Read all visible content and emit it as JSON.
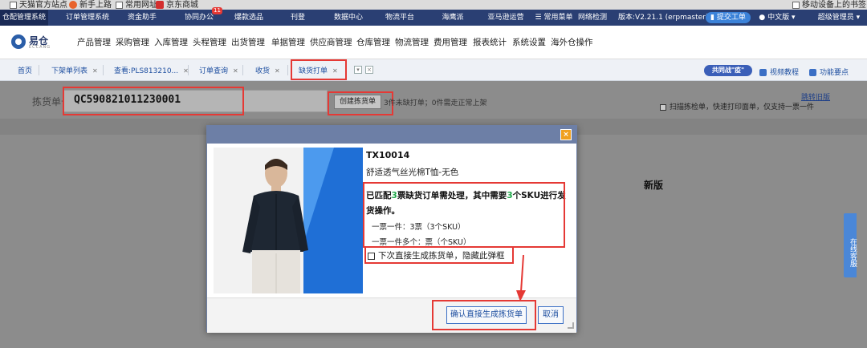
{
  "bookmarks": {
    "items": [
      "天猫官方站点",
      "新手上路",
      "常用网址",
      "京东商城"
    ],
    "right": "移动设备上的书签"
  },
  "topnav": {
    "items": [
      {
        "label": "仓配管理系统",
        "active": true
      },
      {
        "label": "订单管理系统"
      },
      {
        "label": "资金助手"
      },
      {
        "label": "协同办公",
        "badge": "11"
      },
      {
        "label": "爆款选品"
      },
      {
        "label": "刊登"
      },
      {
        "label": "数据中心"
      },
      {
        "label": "物流平台"
      },
      {
        "label": "海鹰派"
      },
      {
        "label": "亚马逊运营"
      },
      {
        "label": "☰ 常用菜单"
      },
      {
        "label": "网络检测"
      }
    ],
    "version": "版本:V2.21.1 (erpmaster)",
    "submit_ticket": "提交工单",
    "language": "中文版",
    "user": "超级管理员"
  },
  "logo": {
    "text": "易仓",
    "sub": "ECCANG"
  },
  "menu": {
    "items": [
      "产品管理",
      "采购管理",
      "入库管理",
      "头程管理",
      "出货管理",
      "单据管理",
      "供应商管理",
      "仓库管理",
      "物流管理",
      "费用管理",
      "报表统计",
      "系统设置",
      "海外仓操作"
    ]
  },
  "tabs": {
    "items": [
      {
        "label": "首页",
        "closable": false
      },
      {
        "label": "下架单列表",
        "closable": true
      },
      {
        "label": "查看:PLS813210...",
        "closable": true
      },
      {
        "label": "订单查询",
        "closable": true
      },
      {
        "label": "收货",
        "closable": true
      },
      {
        "label": "缺货打单",
        "closable": true,
        "active": true
      }
    ],
    "promo": "共同战\"疫\"",
    "video_tutorial": "视频教程",
    "feature_points": "功能要点"
  },
  "pick": {
    "label": "拣货单号",
    "value": "QC590821011230001",
    "create_button": "创建拣货单",
    "note_prefix": "3",
    "note": "件未缺打单；0件需走正常上架",
    "switch_old": "跳转旧版",
    "scan_option": "扫描拣检单，快速打印面单，仅支持一票一件"
  },
  "side": {
    "service": "在线客服"
  },
  "dialog": {
    "sku": "TX10014",
    "product_name": "舒适透气丝光棉T恤-无色",
    "msg_part1": "已匹配",
    "msg_count1": "3",
    "msg_part2": "票缺货订单需处理，其中需要",
    "msg_count2": "3",
    "msg_part3": "个SKU进行发",
    "msg_line2": "货操作。",
    "single": "一票一件：3票（3个SKU）",
    "multi": "一票一件多个：票（个SKU）",
    "option_direct": "下次直接生成拣货单，隐藏此弹框",
    "confirm": "确认直接生成拣货单",
    "cancel": "取消",
    "close": "×"
  },
  "annotation": {
    "new_version": "新版"
  },
  "colors": {
    "nav": "#2a3f73",
    "highlight": "#e53935",
    "accent": "#3b6fc5",
    "count": "#1fa84a"
  }
}
